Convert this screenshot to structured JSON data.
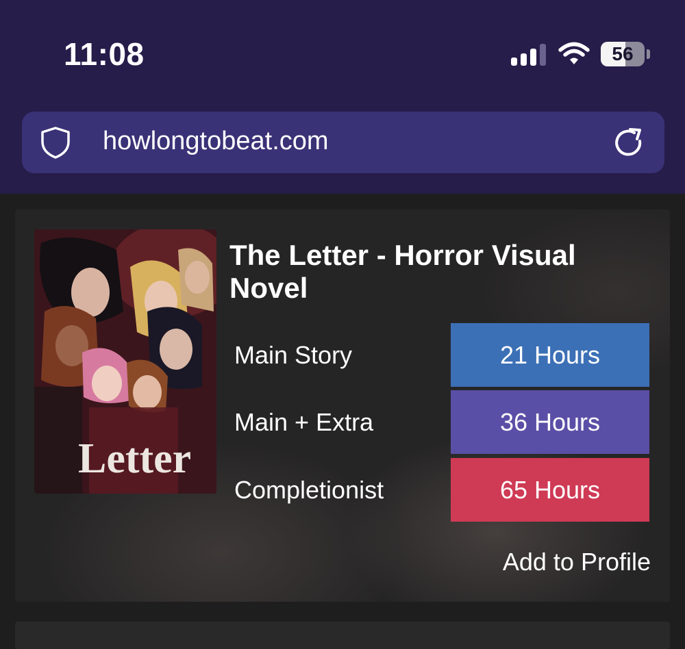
{
  "status_bar": {
    "time": "11:08",
    "battery": "56",
    "battery_fraction": 0.56
  },
  "browser": {
    "url": "howlongtobeat.com",
    "icons": [
      "shield-icon",
      "reload-icon"
    ],
    "chrome_color": "#261d4a",
    "url_bar_color": "#3a3277"
  },
  "game": {
    "title": "The Letter - Horror Visual Novel",
    "cover_text": "Letter",
    "times": [
      {
        "label": "Main Story",
        "value": "21 Hours",
        "color": "#3c70b6"
      },
      {
        "label": "Main + Extra",
        "value": "36 Hours",
        "color": "#5a4fa6"
      },
      {
        "label": "Completionist",
        "value": "65 Hours",
        "color": "#cf3a55"
      }
    ],
    "add_to_profile": "Add to Profile"
  }
}
